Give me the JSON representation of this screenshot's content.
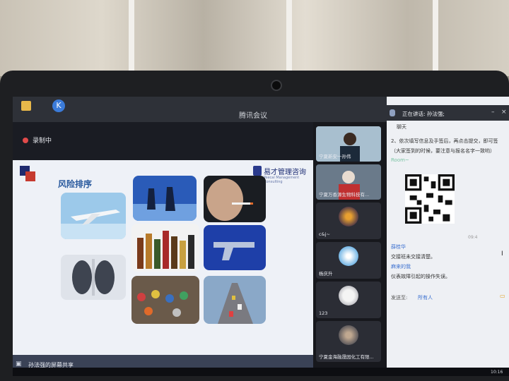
{
  "window": {
    "title": "腾讯会议"
  },
  "recording": {
    "label": "录制中"
  },
  "slide": {
    "title": "风险排序",
    "logo_text": "易才管理咨询",
    "logo_sub": "Yeecai Management Consulting"
  },
  "share": {
    "label": "孙法强的屏幕共享"
  },
  "participants": [
    {
      "name": "宁夏新安一孙伟"
    },
    {
      "name": "宁夏万香源生物科技有..."
    },
    {
      "name": "c&j~"
    },
    {
      "name": "杨庆升"
    },
    {
      "name": "123"
    },
    {
      "name": "宁夏金海融晟园化工有限..."
    }
  ],
  "chat": {
    "speaking": "正在讲话: 孙法强;",
    "title": "聊天",
    "lines": [
      "2、依次填写信息及手签后，再点击提交，即可签",
      "（大家签到的时候，要注意与报名名字一致哟）"
    ],
    "room_label": "Room~",
    "messages": [
      {
        "sender": "薛桂华",
        "text": "交接班未交接清楚。"
      },
      {
        "sender": "麻来的我",
        "text": "仪表故障引起的操作失误。"
      }
    ],
    "send_to_label": "发送至:",
    "send_to_value": "所有人",
    "timestamp": "09:4"
  },
  "clock": "10:16"
}
